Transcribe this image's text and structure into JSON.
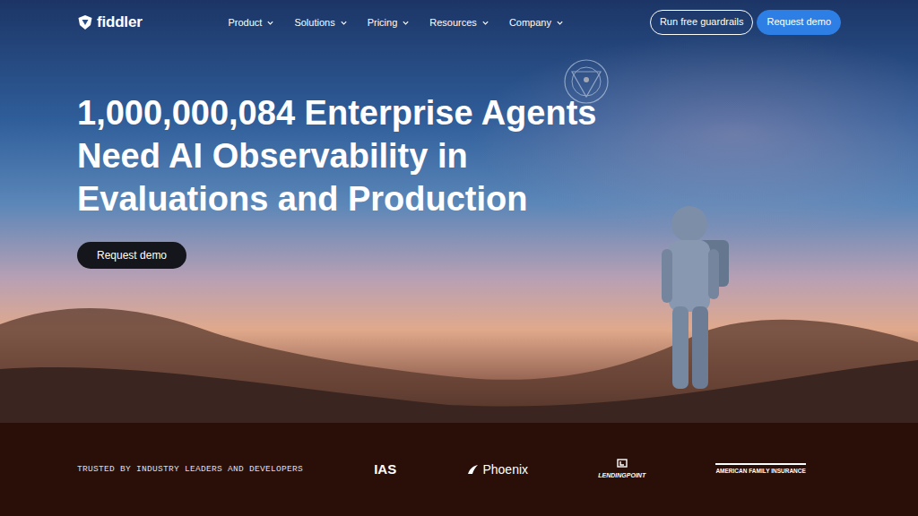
{
  "brand": {
    "name": "fiddler"
  },
  "nav": {
    "items": [
      {
        "label": "Product"
      },
      {
        "label": "Solutions"
      },
      {
        "label": "Pricing"
      },
      {
        "label": "Resources"
      },
      {
        "label": "Company"
      }
    ]
  },
  "actions": [
    {
      "label": "Run free guardrails",
      "kind": "outline"
    },
    {
      "label": "Request demo",
      "kind": "primary"
    }
  ],
  "hero": {
    "title": "1,000,000,084 Enterprise Agents Need AI Observability in Evaluations and Production",
    "button": "Request demo"
  },
  "trust": {
    "label": "TRUSTED BY INDUSTRY LEADERS AND DEVELOPERS",
    "logos": [
      "IAS",
      "Phoenix",
      "LENDINGPOINT",
      "AMERICAN FAMILY INSURANCE"
    ]
  }
}
